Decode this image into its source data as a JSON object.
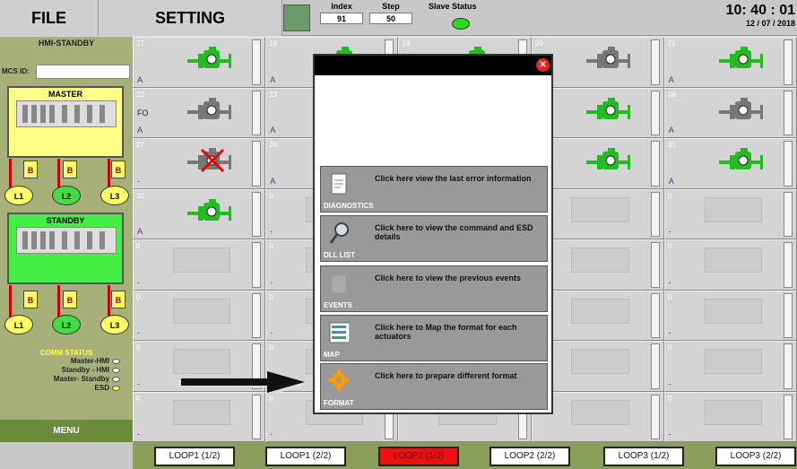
{
  "header": {
    "file_label": "FILE",
    "setting_label": "SETTING",
    "index_label": "Index",
    "index_value": "91",
    "step_label": "Step",
    "step_value": "50",
    "slave_status_label": "Slave Status",
    "time": "10: 40 : 01",
    "date": "12 / 07 / 2018"
  },
  "sidebar": {
    "hmi_title": "HMI-STANDBY",
    "mcs_label": "MCS ID:",
    "mcs_value": "",
    "master_label": "MASTER",
    "standby_label": "STANDBY",
    "b_label": "B",
    "loops": [
      "L1",
      "L2",
      "L3"
    ],
    "comm_title": "COMM STATUS",
    "comm_items": [
      "Master-HMI",
      "Standby - HMI",
      "Master- Standby",
      "ESD"
    ],
    "menu_label": "MENU"
  },
  "grid": {
    "cells": [
      {
        "num": "17",
        "status": "A",
        "fo": "",
        "act": "green"
      },
      {
        "num": "18",
        "status": "A",
        "fo": "",
        "act": "green"
      },
      {
        "num": "19",
        "status": "",
        "fo": "",
        "act": "green"
      },
      {
        "num": "20",
        "status": "",
        "fo": "",
        "act": "gray"
      },
      {
        "num": "21",
        "status": "A",
        "fo": "",
        "act": "green"
      },
      {
        "num": "22",
        "status": "A",
        "fo": "FO",
        "act": "gray"
      },
      {
        "num": "23",
        "status": "A",
        "fo": "",
        "act": ""
      },
      {
        "num": "",
        "status": "",
        "fo": "",
        "act": ""
      },
      {
        "num": "",
        "status": "",
        "fo": "",
        "act": "green"
      },
      {
        "num": "26",
        "status": "A",
        "fo": "",
        "act": "gray"
      },
      {
        "num": "27",
        "status": "-",
        "fo": "",
        "act": "fault"
      },
      {
        "num": "28",
        "status": "A",
        "fo": "",
        "act": ""
      },
      {
        "num": "",
        "status": "",
        "fo": "",
        "act": ""
      },
      {
        "num": "",
        "status": "",
        "fo": "",
        "act": "green"
      },
      {
        "num": "31",
        "status": "A",
        "fo": "",
        "act": "green"
      },
      {
        "num": "32",
        "status": "A",
        "fo": "",
        "act": "green"
      },
      {
        "num": "0",
        "status": "-",
        "fo": "",
        "act": ""
      },
      {
        "num": "",
        "status": "",
        "fo": "",
        "act": ""
      },
      {
        "num": "",
        "status": "",
        "fo": "",
        "act": ""
      },
      {
        "num": "0",
        "status": "-",
        "fo": "",
        "act": ""
      },
      {
        "num": "0",
        "status": "-",
        "fo": "",
        "act": ""
      },
      {
        "num": "0",
        "status": "-",
        "fo": "",
        "act": ""
      },
      {
        "num": "",
        "status": "",
        "fo": "",
        "act": ""
      },
      {
        "num": "",
        "status": "",
        "fo": "",
        "act": ""
      },
      {
        "num": "0",
        "status": "-",
        "fo": "",
        "act": ""
      },
      {
        "num": "0",
        "status": "-",
        "fo": "",
        "act": ""
      },
      {
        "num": "0",
        "status": "-",
        "fo": "",
        "act": ""
      },
      {
        "num": "",
        "status": "",
        "fo": "",
        "act": ""
      },
      {
        "num": "",
        "status": "",
        "fo": "",
        "act": ""
      },
      {
        "num": "0",
        "status": "-",
        "fo": "",
        "act": ""
      },
      {
        "num": "0",
        "status": "-",
        "fo": "",
        "act": ""
      },
      {
        "num": "0",
        "status": "-",
        "fo": "",
        "act": ""
      },
      {
        "num": "",
        "status": "",
        "fo": "",
        "act": ""
      },
      {
        "num": "",
        "status": "",
        "fo": "",
        "act": ""
      },
      {
        "num": "0",
        "status": "-",
        "fo": "",
        "act": ""
      },
      {
        "num": "0",
        "status": "-",
        "fo": "",
        "act": ""
      },
      {
        "num": "0",
        "status": "-",
        "fo": "",
        "act": ""
      },
      {
        "num": "",
        "status": "",
        "fo": "",
        "act": ""
      },
      {
        "num": "",
        "status": "",
        "fo": "",
        "act": ""
      },
      {
        "num": "0",
        "status": "-",
        "fo": "",
        "act": ""
      }
    ]
  },
  "popup": {
    "buttons": [
      {
        "label": "DIAGNOSTICS",
        "text": "Click here view the last error information",
        "icon": "document-icon"
      },
      {
        "label": "DLL LIST",
        "text": "Click here to view the command and ESD details",
        "icon": "magnifier-icon"
      },
      {
        "label": "EVENTS",
        "text": "Click here to view the previous events",
        "icon": "events-icon"
      },
      {
        "label": "MAP",
        "text": "Click here to Map the format for each actuators",
        "icon": "map-icon"
      },
      {
        "label": "FORMAT",
        "text": "Click here to prepare different format",
        "icon": "gear-icon"
      }
    ]
  },
  "tabs": [
    "LOOP1 (1/2)",
    "LOOP1 (2/2)",
    "LOOP2 (1/2)",
    "LOOP2 (2/2)",
    "LOOP3 (1/2)",
    "LOOP3 (2/2)"
  ],
  "active_tab": "LOOP2 (1/2)",
  "colors": {
    "active_tab": "#ee1111",
    "actuator_green": "#22bb22",
    "master_panel": "#ffff88",
    "standby_panel": "#44ee44",
    "menu_bg": "#6b8a3b"
  }
}
